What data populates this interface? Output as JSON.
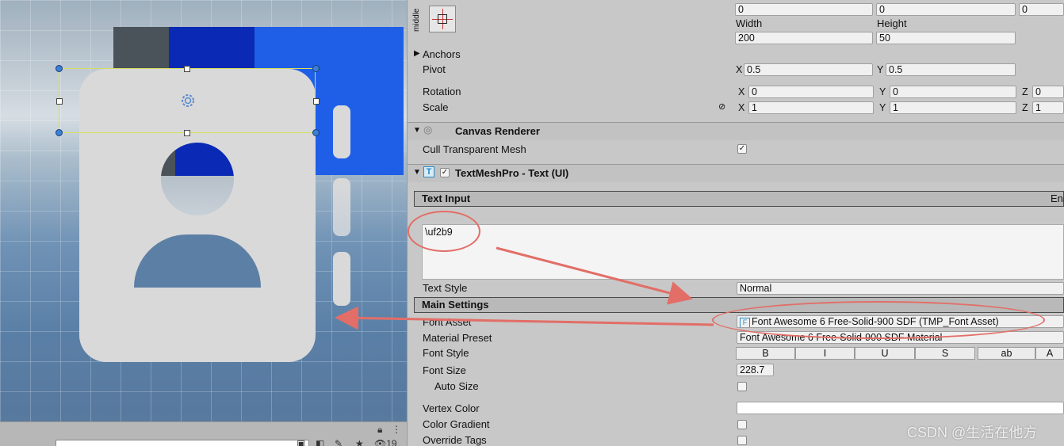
{
  "scene": {
    "colors": {
      "card": "#d9d9d9",
      "blue_dark": "#0a2ab5",
      "blue_light": "#1f5fe8",
      "gray_dark": "#4a525a",
      "selection": "#d7e05c"
    },
    "toolbar": {
      "layer_count": "19",
      "search_text": ""
    }
  },
  "rect_transform": {
    "anchor_label": "middle",
    "pos_values": [
      "0",
      "0",
      "0"
    ],
    "width_label": "Width",
    "height_label": "Height",
    "width": "200",
    "height": "50",
    "anchors_label": "Anchors",
    "pivot_label": "Pivot",
    "pivot_x": "0.5",
    "pivot_y": "0.5",
    "rotation_label": "Rotation",
    "rotation": {
      "x": "0",
      "y": "0",
      "z": "0"
    },
    "scale_label": "Scale",
    "scale": {
      "x": "1",
      "y": "1",
      "z": "1"
    },
    "axis_x": "X",
    "axis_y": "Y",
    "axis_z": "Z"
  },
  "canvas_renderer": {
    "title": "Canvas Renderer",
    "cull_label": "Cull Transparent Mesh",
    "cull_checked": "✓"
  },
  "tmp": {
    "title": "TextMeshPro - Text (UI)",
    "enabled_check": "✓",
    "text_input_label": "Text Input",
    "enable_rtl_label": "Ena",
    "text_value": "\\uf2b9",
    "text_style_label": "Text Style",
    "text_style_value": "Normal",
    "main_settings_label": "Main Settings",
    "font_asset_label": "Font Asset",
    "font_asset_value": "Font Awesome 6 Free-Solid-900 SDF (TMP_Font Asset)",
    "material_preset_label": "Material Preset",
    "material_preset_value": "Font Awesome 6 Free-Solid-900 SDF Material",
    "font_style_label": "Font Style",
    "font_style_buttons": [
      "B",
      "I",
      "U",
      "S",
      "ab",
      "A"
    ],
    "font_size_label": "Font Size",
    "font_size_value": "228.7",
    "auto_size_label": "Auto Size",
    "vertex_color_label": "Vertex Color",
    "color_gradient_label": "Color Gradient",
    "override_tags_label": "Override Tags"
  },
  "watermark": "CSDN @生活在他方",
  "annotation_color": "#e26e67"
}
